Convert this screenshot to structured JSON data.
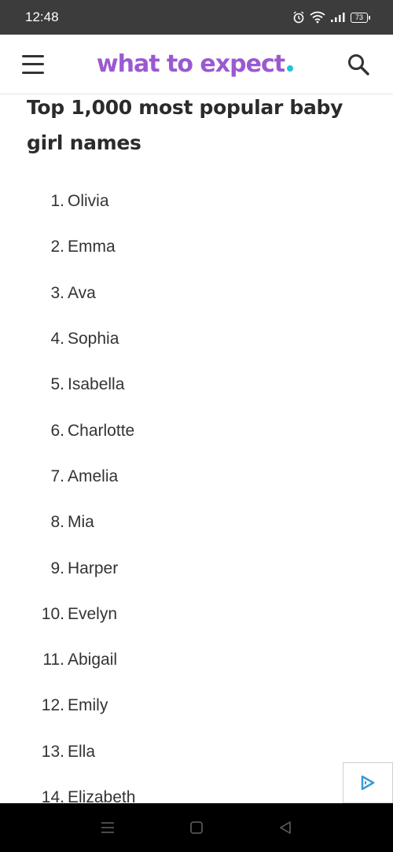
{
  "status_bar": {
    "time": "12:48",
    "battery": "73",
    "icons": [
      "alarm-icon",
      "wifi-icon",
      "signal-icon",
      "battery-icon"
    ]
  },
  "header": {
    "logo_text": "what to expect",
    "menu_icon": "hamburger-menu-icon",
    "search_icon": "search-icon",
    "colors": {
      "brand": "#9b59d0",
      "dot": "#21c4d6"
    }
  },
  "article": {
    "title": "Top 1,000 most popular baby girl names",
    "names": [
      {
        "num": "1.",
        "name": "Olivia"
      },
      {
        "num": "2.",
        "name": "Emma"
      },
      {
        "num": "3.",
        "name": "Ava"
      },
      {
        "num": "4.",
        "name": "Sophia"
      },
      {
        "num": "5.",
        "name": "Isabella"
      },
      {
        "num": "6.",
        "name": "Charlotte"
      },
      {
        "num": "7.",
        "name": "Amelia"
      },
      {
        "num": "8.",
        "name": "Mia"
      },
      {
        "num": "9.",
        "name": "Harper"
      },
      {
        "num": "10.",
        "name": "Evelyn"
      },
      {
        "num": "11.",
        "name": "Abigail"
      },
      {
        "num": "12.",
        "name": "Emily"
      },
      {
        "num": "13.",
        "name": "Ella"
      },
      {
        "num": "14.",
        "name": "Elizabeth"
      }
    ]
  },
  "ad": {
    "icon": "ad-choices-icon"
  },
  "nav_bar": {
    "buttons": [
      "recents-icon",
      "home-icon",
      "back-icon"
    ]
  }
}
